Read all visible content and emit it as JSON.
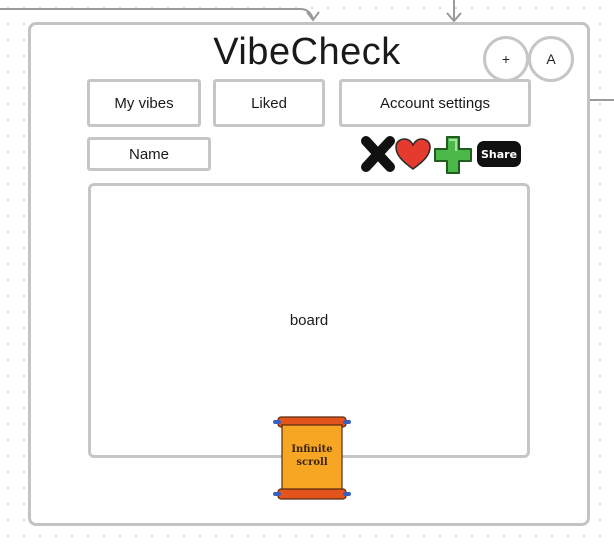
{
  "header": {
    "title": "VibeCheck",
    "add_button_label": "+",
    "avatar_label": "A"
  },
  "nav": {
    "items": [
      {
        "label": "My vibes"
      },
      {
        "label": "Liked"
      },
      {
        "label": "Account settings"
      }
    ]
  },
  "name_field": {
    "label": "Name"
  },
  "actions": {
    "icons": [
      "close-x-icon",
      "heart-icon",
      "plus-icon",
      "share-icon"
    ],
    "share_label": "Share"
  },
  "board": {
    "label": "board"
  },
  "scroll_sticker": {
    "line1": "Infinite",
    "line2": "scroll"
  },
  "colors": {
    "border": "#c6c6c6",
    "heart": "#e53a2e",
    "plus": "#4cb84a",
    "scroll_paper": "#f6a623",
    "scroll_roll": "#e2541b"
  }
}
